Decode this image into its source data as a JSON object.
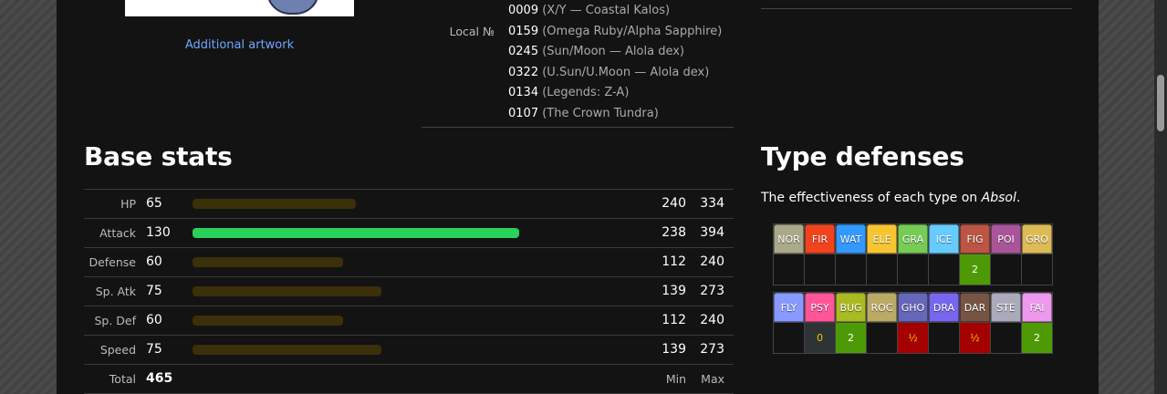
{
  "artwork": {
    "additional_label": "Additional artwork"
  },
  "local_dex": {
    "label": "Local №",
    "entries": [
      {
        "num": "0009",
        "note": "(X/Y — Coastal Kalos)"
      },
      {
        "num": "0159",
        "note": "(Omega Ruby/Alpha Sapphire)"
      },
      {
        "num": "0245",
        "note": "(Sun/Moon — Alola dex)"
      },
      {
        "num": "0322",
        "note": "(U.Sun/U.Moon — Alola dex)"
      },
      {
        "num": "0134",
        "note": "(Legends: Z-A)"
      },
      {
        "num": "0107",
        "note": "(The Crown Tundra)"
      }
    ]
  },
  "base_stats": {
    "title": "Base stats",
    "rows": [
      {
        "label": "HP",
        "value": "65",
        "min": "240",
        "max": "334",
        "fraction": 0.256,
        "highlight": false
      },
      {
        "label": "Attack",
        "value": "130",
        "min": "238",
        "max": "394",
        "fraction": 0.512,
        "highlight": true
      },
      {
        "label": "Defense",
        "value": "60",
        "min": "112",
        "max": "240",
        "fraction": 0.236,
        "highlight": false
      },
      {
        "label": "Sp. Atk",
        "value": "75",
        "min": "139",
        "max": "273",
        "fraction": 0.295,
        "highlight": false
      },
      {
        "label": "Sp. Def",
        "value": "60",
        "min": "112",
        "max": "240",
        "fraction": 0.236,
        "highlight": false
      },
      {
        "label": "Speed",
        "value": "75",
        "min": "139",
        "max": "273",
        "fraction": 0.295,
        "highlight": false
      }
    ],
    "total": {
      "label": "Total",
      "value": "465",
      "min_label": "Min",
      "max_label": "Max"
    },
    "colors": {
      "bar_default": "#3b300a",
      "bar_high": "#29d15b"
    }
  },
  "type_defenses": {
    "title": "Type defenses",
    "desc_prefix": "The effectiveness of each type on ",
    "pokemon": "Absol",
    "desc_suffix": ".",
    "rows": [
      [
        {
          "abbr": "NOR",
          "color": "#aaa98a",
          "mult": ""
        },
        {
          "abbr": "FIR",
          "color": "#f2431f",
          "mult": ""
        },
        {
          "abbr": "WAT",
          "color": "#3399ff",
          "mult": ""
        },
        {
          "abbr": "ELE",
          "color": "#f6c531",
          "mult": ""
        },
        {
          "abbr": "GRA",
          "color": "#77cc55",
          "mult": ""
        },
        {
          "abbr": "ICE",
          "color": "#66ccff",
          "mult": ""
        },
        {
          "abbr": "FIG",
          "color": "#bb5544",
          "mult": "2"
        },
        {
          "abbr": "POI",
          "color": "#aa5599",
          "mult": ""
        },
        {
          "abbr": "GRO",
          "color": "#ddbb55",
          "mult": ""
        }
      ],
      [
        {
          "abbr": "FLY",
          "color": "#8899ff",
          "mult": ""
        },
        {
          "abbr": "PSY",
          "color": "#ff5599",
          "mult": ""
        },
        {
          "abbr": "BUG",
          "color": "#aabb22",
          "mult": "2"
        },
        {
          "abbr": "ROC",
          "color": "#bbaa66",
          "mult": ""
        },
        {
          "abbr": "GHO",
          "color": "#6666bb",
          "mult": "½"
        },
        {
          "abbr": "DRA",
          "color": "#7766ee",
          "mult": ""
        },
        {
          "abbr": "DAR",
          "color": "#775544",
          "mult": "½"
        },
        {
          "abbr": "STE",
          "color": "#aaaabb",
          "mult": ""
        },
        {
          "abbr": "FAI",
          "color": "#ee99ee",
          "mult": "2"
        }
      ]
    ],
    "psychic_mult": "0",
    "mult_colors": {
      "2": "#4e9a06",
      "½": "#a40000",
      "0": "#2e3436"
    }
  }
}
